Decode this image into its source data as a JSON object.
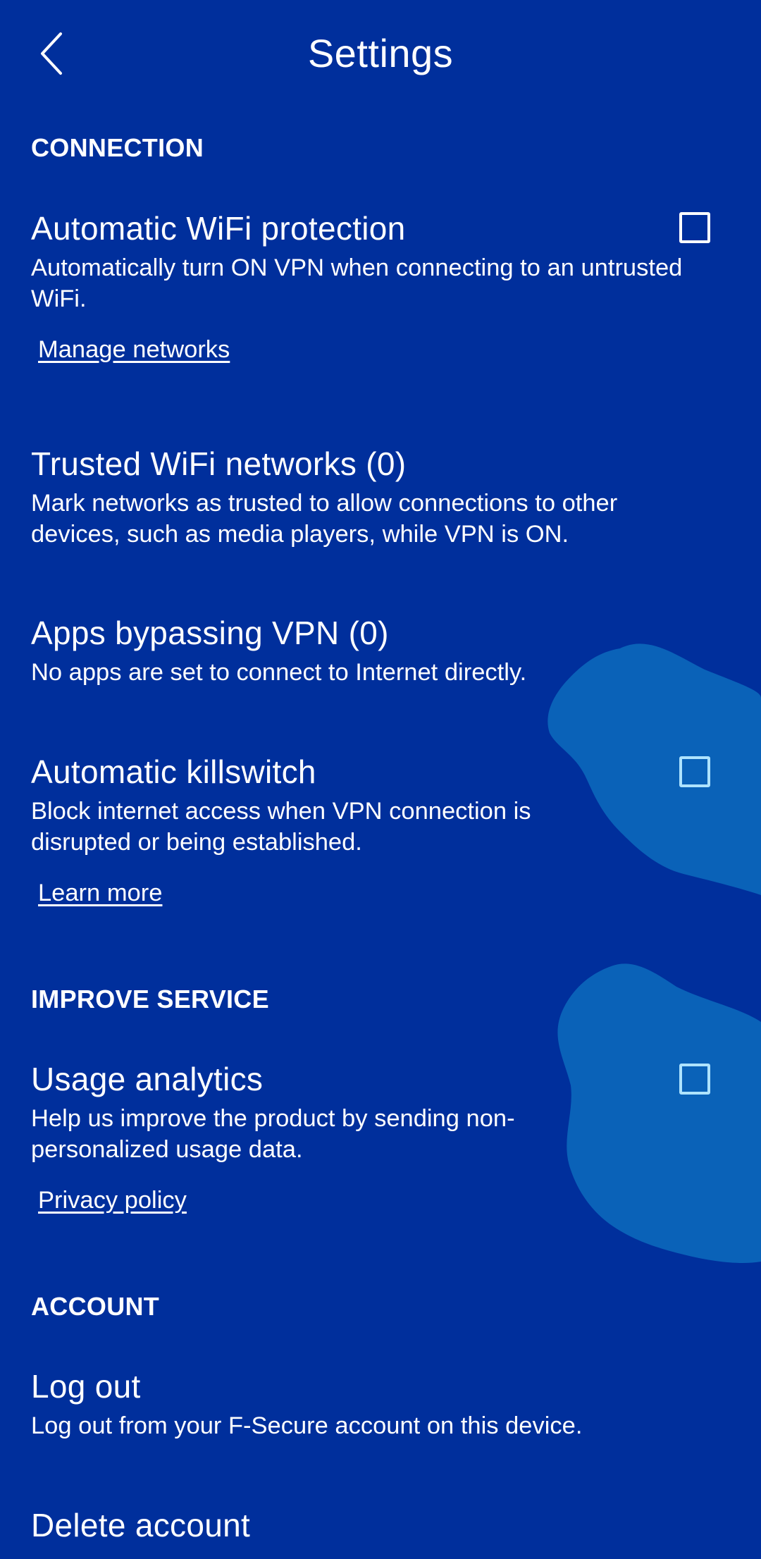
{
  "header": {
    "title": "Settings",
    "back_icon": "chevron-left-icon"
  },
  "colors": {
    "background": "#002f9c",
    "decoration": "#0a62b8",
    "checkbox_border": "#ffffff",
    "checkbox_border_light": "#aee3ff",
    "text": "#ffffff"
  },
  "sections": {
    "connection": {
      "label": "CONNECTION"
    },
    "improve_service": {
      "label": "IMPROVE SERVICE"
    },
    "account": {
      "label": "ACCOUNT"
    }
  },
  "settings": {
    "auto_wifi": {
      "title": "Automatic WiFi protection",
      "description": "Automatically turn ON VPN when connecting to an untrusted WiFi.",
      "link": "Manage networks",
      "checked": false
    },
    "trusted_wifi": {
      "title": "Trusted WiFi networks (0)",
      "description": "Mark networks as trusted to allow connections to other devices, such as media players, while VPN is ON."
    },
    "apps_bypassing": {
      "title": "Apps bypassing VPN (0)",
      "description": "No apps are set to connect to Internet directly."
    },
    "killswitch": {
      "title": "Automatic killswitch",
      "description": "Block internet access when VPN connection is disrupted or being established.",
      "link": "Learn more",
      "checked": false
    },
    "usage_analytics": {
      "title": "Usage analytics",
      "description": "Help us improve the product by sending non-personalized usage data.",
      "link": "Privacy policy",
      "checked": false
    },
    "log_out": {
      "title": "Log out",
      "description": "Log out from your F-Secure account on this device."
    },
    "delete_account": {
      "title": "Delete account"
    }
  }
}
